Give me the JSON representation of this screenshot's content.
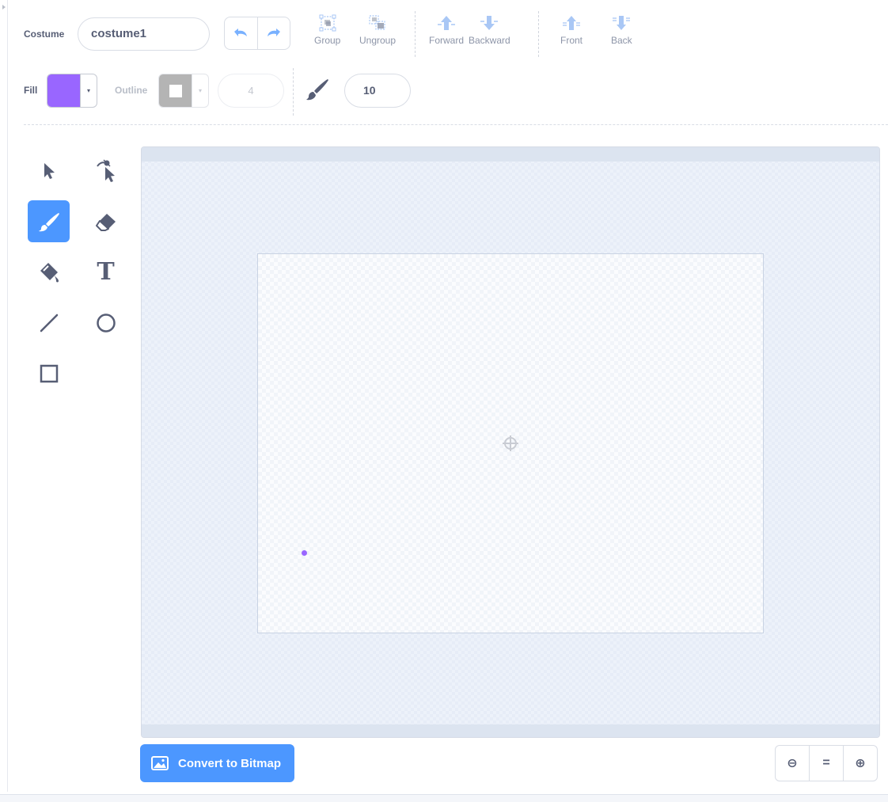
{
  "costume": {
    "label": "Costume",
    "name_value": "costume1"
  },
  "toolbar": {
    "group_label": "Group",
    "ungroup_label": "Ungroup",
    "forward_label": "Forward",
    "backward_label": "Backward",
    "front_label": "Front",
    "back_label": "Back"
  },
  "fill": {
    "label": "Fill",
    "color": "#9966ff",
    "dropdown_glyph": "▾"
  },
  "outline": {
    "label": "Outline",
    "color": "#b4b4b4",
    "width_value": "4",
    "dropdown_glyph": "▾"
  },
  "brush": {
    "size_value": "10"
  },
  "tools": [
    {
      "name": "select-tool",
      "icon": "arrow-cursor-icon"
    },
    {
      "name": "reshape-tool",
      "icon": "reshape-cursor-icon"
    },
    {
      "name": "brush-tool",
      "icon": "brush-icon",
      "active": true
    },
    {
      "name": "eraser-tool",
      "icon": "eraser-icon"
    },
    {
      "name": "fill-tool",
      "icon": "paint-bucket-icon"
    },
    {
      "name": "text-tool",
      "icon": "text-icon",
      "glyph": "T"
    },
    {
      "name": "line-tool",
      "icon": "line-icon"
    },
    {
      "name": "circle-tool",
      "icon": "circle-icon"
    },
    {
      "name": "rectangle-tool",
      "icon": "rectangle-icon"
    }
  ],
  "canvas": {
    "brush_color": "#9966ff"
  },
  "bottom": {
    "convert_label": "Convert to Bitmap",
    "zoom_out_glyph": "⊖",
    "zoom_reset_glyph": "=",
    "zoom_in_glyph": "⊕"
  },
  "colors": {
    "accent": "#4c97ff",
    "text": "#575e75",
    "disabled": "#8d95a8"
  }
}
